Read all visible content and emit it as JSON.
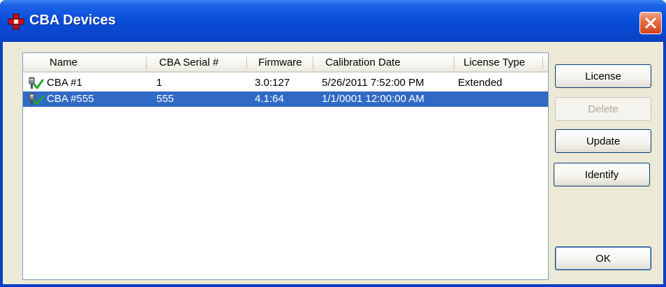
{
  "window": {
    "title": "CBA Devices",
    "icon": "red-cross-app-icon",
    "close_icon": "close-x-icon"
  },
  "listview": {
    "columns": [
      "Name",
      "CBA Serial #",
      "Firmware",
      "Calibration Date",
      "License Type"
    ],
    "rows": [
      {
        "icon": "connected-device-check-icon",
        "name": "CBA #1",
        "serial": "1",
        "firmware": "3.0:127",
        "calibration_date": "5/26/2011 7:52:00 PM",
        "license_type": "Extended",
        "selected": false
      },
      {
        "icon": "connected-device-check-icon",
        "name": "CBA #555",
        "serial": "555",
        "firmware": "4.1:64",
        "calibration_date": "1/1/0001 12:00:00 AM",
        "license_type": "",
        "selected": true
      }
    ]
  },
  "buttons": {
    "license": "License",
    "delete": "Delete",
    "update": "Update",
    "identify": "Identify",
    "ok": "OK"
  },
  "colors": {
    "titlebar": "#0a4fd9",
    "selection": "#316ac5",
    "face": "#ece9d8",
    "close": "#e56b3f"
  }
}
